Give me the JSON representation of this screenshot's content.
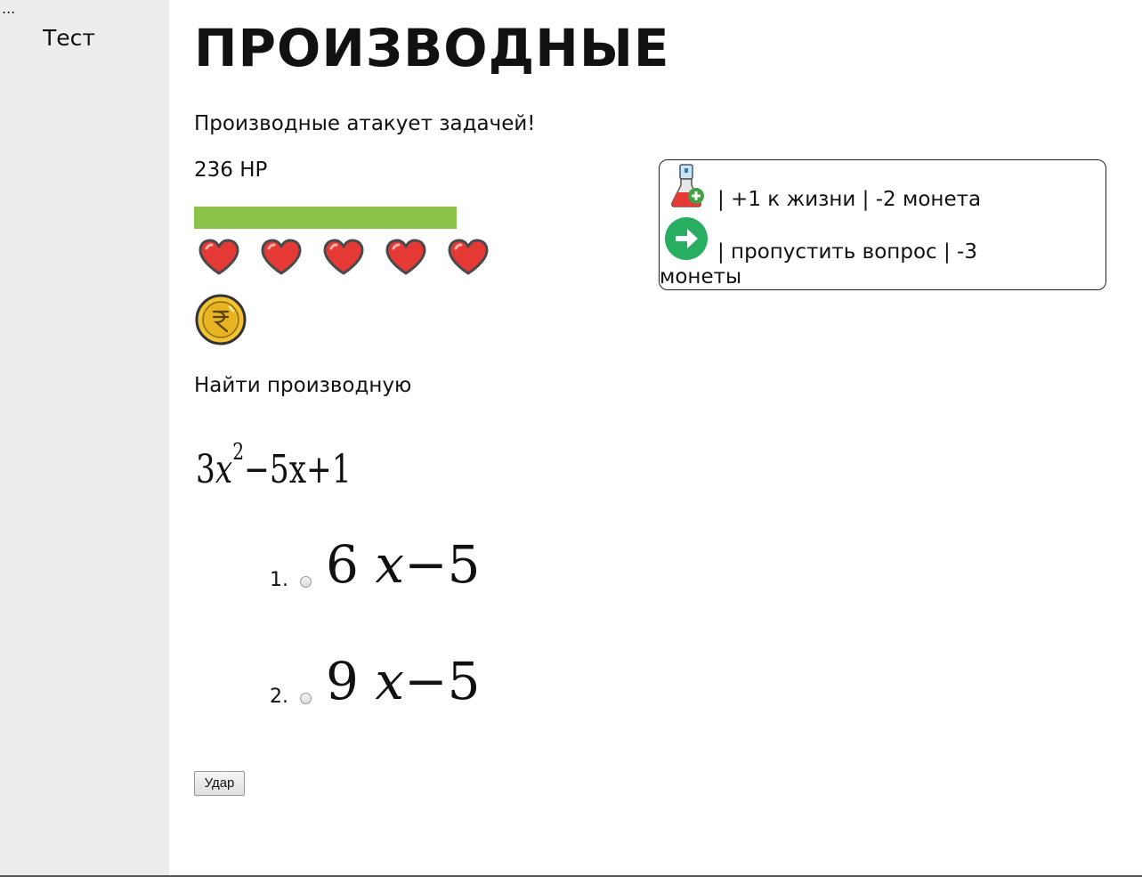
{
  "sidebar": {
    "dots": "...",
    "link": "Тест"
  },
  "main": {
    "title": "ПРОИЗВОДНЫЕ",
    "attack_text": "Производные атакует задачей!",
    "hp_text": "236 HP",
    "hp_fraction": 0.4,
    "hp_color": "#8bc34a",
    "hearts": [
      {
        "icon": "heart-icon"
      },
      {
        "icon": "heart-icon"
      },
      {
        "icon": "heart-icon"
      },
      {
        "icon": "heart-icon"
      },
      {
        "icon": "heart-icon"
      }
    ],
    "coin_icon": "rupee-coin-icon",
    "task_label": "Найти производную",
    "formula": {
      "coef": "3",
      "var": "x",
      "power": "2",
      "rest": "−5x+1"
    },
    "options": [
      {
        "num": "1.",
        "coef": "6",
        "var": "x",
        "rest": "−5"
      },
      {
        "num": "2.",
        "coef": "9",
        "var": "x",
        "rest": "−5"
      }
    ],
    "hit_button": "Удар"
  },
  "shop": {
    "items": [
      {
        "icon": "potion-flask-icon",
        "text": "| +1 к жизни | -2 монета"
      },
      {
        "icon": "skip-arrow-icon",
        "text": "| пропустить вопрос | -3",
        "text_cont": "монеты"
      }
    ]
  }
}
